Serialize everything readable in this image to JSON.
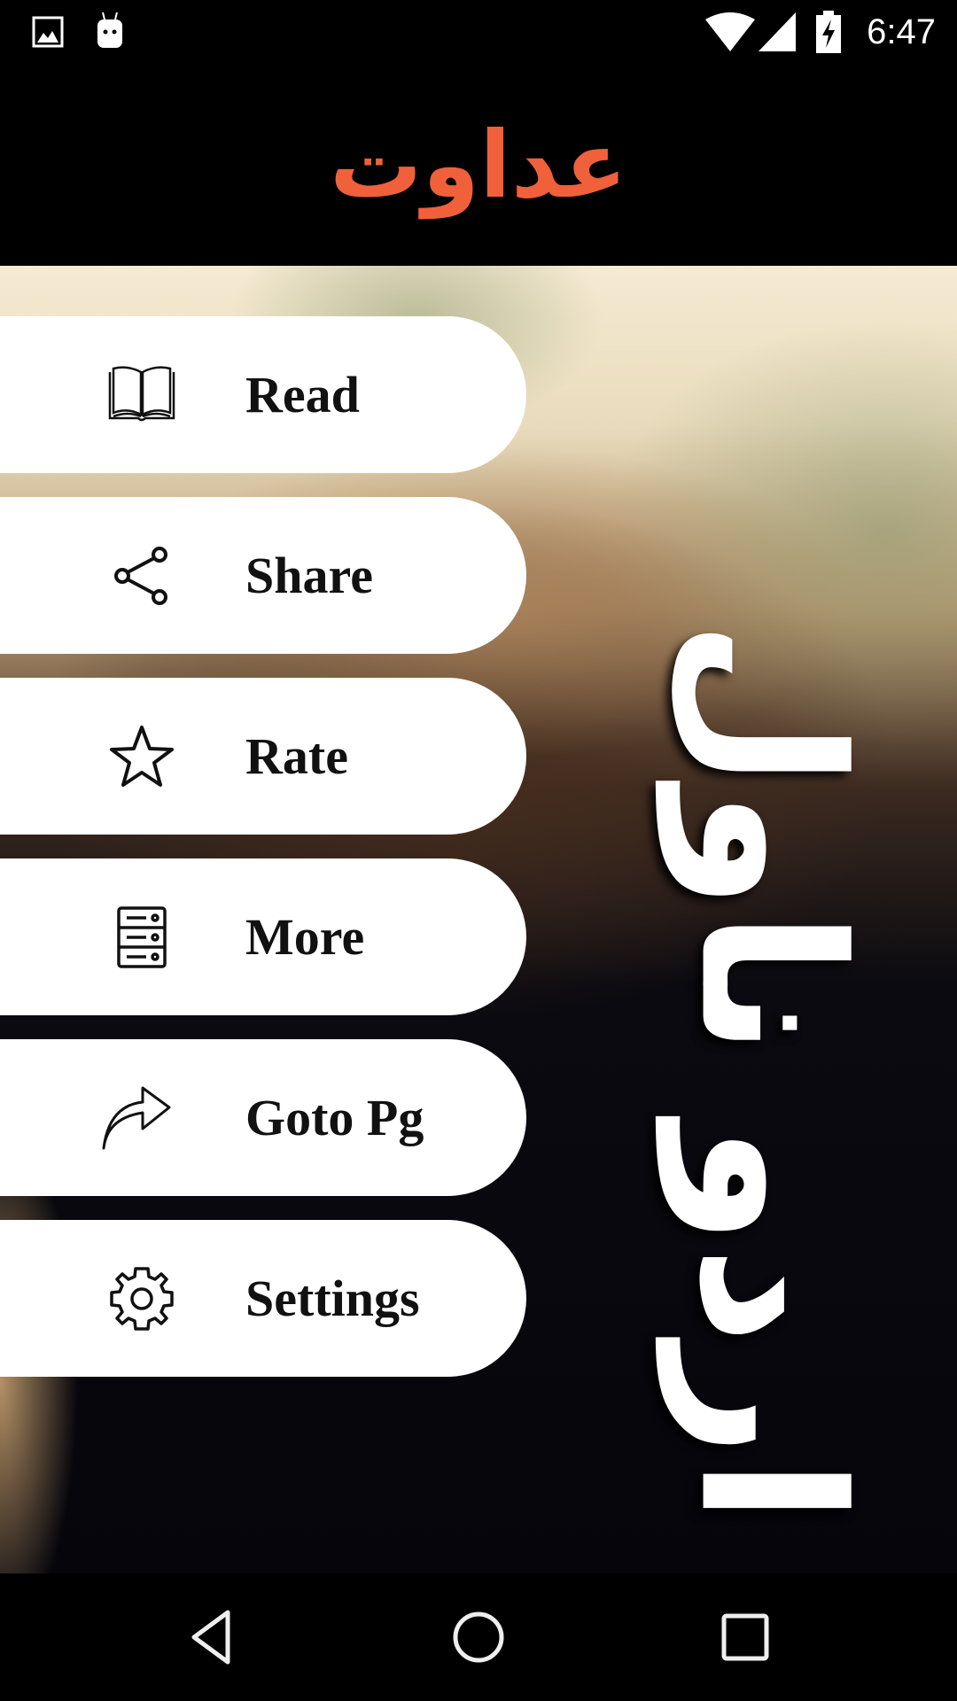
{
  "status_bar": {
    "left_icons": [
      "gallery-notification-icon",
      "android-notification-icon"
    ],
    "right_icons": [
      "wifi-icon",
      "cellular-signal-icon",
      "battery-charging-icon"
    ],
    "time": "6:47"
  },
  "app_bar": {
    "title": "عداوت",
    "title_color": "#F0603A"
  },
  "background": {
    "watermark_text": "اردو ناول"
  },
  "menu": {
    "items": [
      {
        "label": "Read",
        "icon": "book-open-icon"
      },
      {
        "label": "Share",
        "icon": "share-icon"
      },
      {
        "label": "Rate",
        "icon": "star-icon"
      },
      {
        "label": "More",
        "icon": "server-stack-icon"
      },
      {
        "label": "Goto Pg",
        "icon": "forward-arrow-icon"
      },
      {
        "label": "Settings",
        "icon": "gear-icon"
      }
    ]
  },
  "nav_bar": {
    "buttons": [
      "back",
      "home",
      "recents"
    ]
  }
}
